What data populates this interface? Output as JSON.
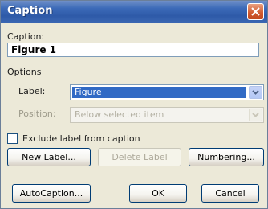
{
  "window": {
    "title": "Caption"
  },
  "caption": {
    "label": "Caption:",
    "value": "Figure 1"
  },
  "options": {
    "group_label": "Options",
    "label_label": "Label:",
    "label_value": "Figure",
    "position_label": "Position:",
    "position_value": "Below selected item"
  },
  "exclude_checkbox": {
    "label": "Exclude label from caption",
    "checked": false
  },
  "buttons": {
    "new_label": "New Label...",
    "delete_label": "Delete Label",
    "numbering": "Numbering...",
    "autocaption": "AutoCaption...",
    "ok": "OK",
    "cancel": "Cancel"
  },
  "colors": {
    "titlebar": "#2e5aa8",
    "selection": "#316ac5",
    "dialog_bg": "#ece9d8",
    "close_button": "#d0582d"
  }
}
